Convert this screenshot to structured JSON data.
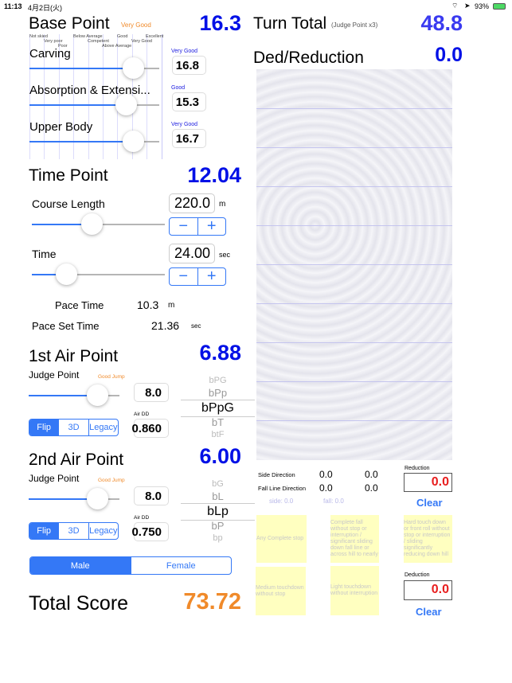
{
  "status_bar": {
    "time": "11:13",
    "date": "4月2日(火)",
    "battery": "93%",
    "icons": [
      "wifi-icon",
      "location-icon",
      "battery-charging-icon"
    ]
  },
  "base_point": {
    "title": "Base Point",
    "rating": "Very Good",
    "value": "16.3",
    "scale_labels": [
      "Not skied",
      "Very poor",
      "Poor",
      "Below Average",
      "Competent",
      "Above Average",
      "Good",
      "Very Good",
      "Excellent"
    ],
    "items": [
      {
        "label": "Carving",
        "rating": "Very Good",
        "value": "16.8",
        "slider": 0.8
      },
      {
        "label": "Absorption & Extensi...",
        "rating": "Good",
        "value": "15.3",
        "slider": 0.74
      },
      {
        "label": "Upper Body",
        "rating": "Very Good",
        "value": "16.7",
        "slider": 0.8
      }
    ]
  },
  "time_point": {
    "title": "Time Point",
    "value": "12.04",
    "course_length": {
      "label": "Course Length",
      "value": "220.0",
      "unit": "m",
      "slider": 0.45
    },
    "time": {
      "label": "Time",
      "value": "24.00",
      "unit": "sec",
      "slider": 0.26
    },
    "minus": "−",
    "plus": "+",
    "pace_time": {
      "label": "Pace Time",
      "value": "10.3",
      "unit": "m"
    },
    "pace_set_time": {
      "label": "Pace Set Time",
      "value": "21.36",
      "unit": "sec"
    }
  },
  "air1": {
    "title": "1st Air Point",
    "value": "6.88",
    "judge_label": "Judge Point",
    "judge_rating": "Good Jump",
    "judge_value": "8.0",
    "slider": 0.75,
    "segments": [
      "Flip",
      "3D",
      "Legacy"
    ],
    "selected": "Flip",
    "dd_label": "Air DD",
    "dd_value": "0.860",
    "picker": [
      "bPG",
      "bPp",
      "bPpG",
      "bT",
      "btF"
    ],
    "picker_selected": "bPpG"
  },
  "air2": {
    "title": "2nd Air Point",
    "value": "6.00",
    "judge_label": "Judge Point",
    "judge_rating": "Good Jump",
    "judge_value": "8.0",
    "slider": 0.75,
    "segments": [
      "Flip",
      "3D",
      "Legacy"
    ],
    "selected": "Flip",
    "dd_label": "Air DD",
    "dd_value": "0.750",
    "picker": [
      "bG",
      "bL",
      "bLp",
      "bP",
      "bp"
    ],
    "picker_selected": "bLp"
  },
  "gender": {
    "options": [
      "Male",
      "Female"
    ],
    "selected": "Male"
  },
  "total": {
    "label": "Total Score",
    "value": "73.72"
  },
  "turn_total": {
    "title": "Turn Total",
    "note": "(Judge Point x3)",
    "value": "48.8"
  },
  "ded_reduction": {
    "title": "Ded/Reduction",
    "value": "0.0"
  },
  "directions": {
    "side_label": "Side Direction",
    "side_values": [
      "0.0",
      "0.0"
    ],
    "fall_label": "Fall Line Direction",
    "fall_values": [
      "0.0",
      "0.0"
    ],
    "side_summary": "side:   0.0",
    "fall_summary": "fall:   0.0"
  },
  "reduction": {
    "label": "Reduction",
    "value": "0.0",
    "clear": "Clear"
  },
  "deduction": {
    "label": "Deduction",
    "value": "0.0",
    "clear": "Clear"
  },
  "deduction_buttons": [
    "Any Complete stop",
    "Complete fall without stop or interruption / significant sliding down fall line or across hill to nearly",
    "Hard touch down or front roll without stop or interruption / sliding significantly reducing down hill",
    "Medium touchdown without stop",
    "Light touchdown without interruption"
  ],
  "colors": {
    "accent": "#3478f6",
    "score_blue": "#0010e6",
    "total_orange": "#f08a2a",
    "red": "#e81e1e",
    "yellow": "#ffffc0"
  }
}
